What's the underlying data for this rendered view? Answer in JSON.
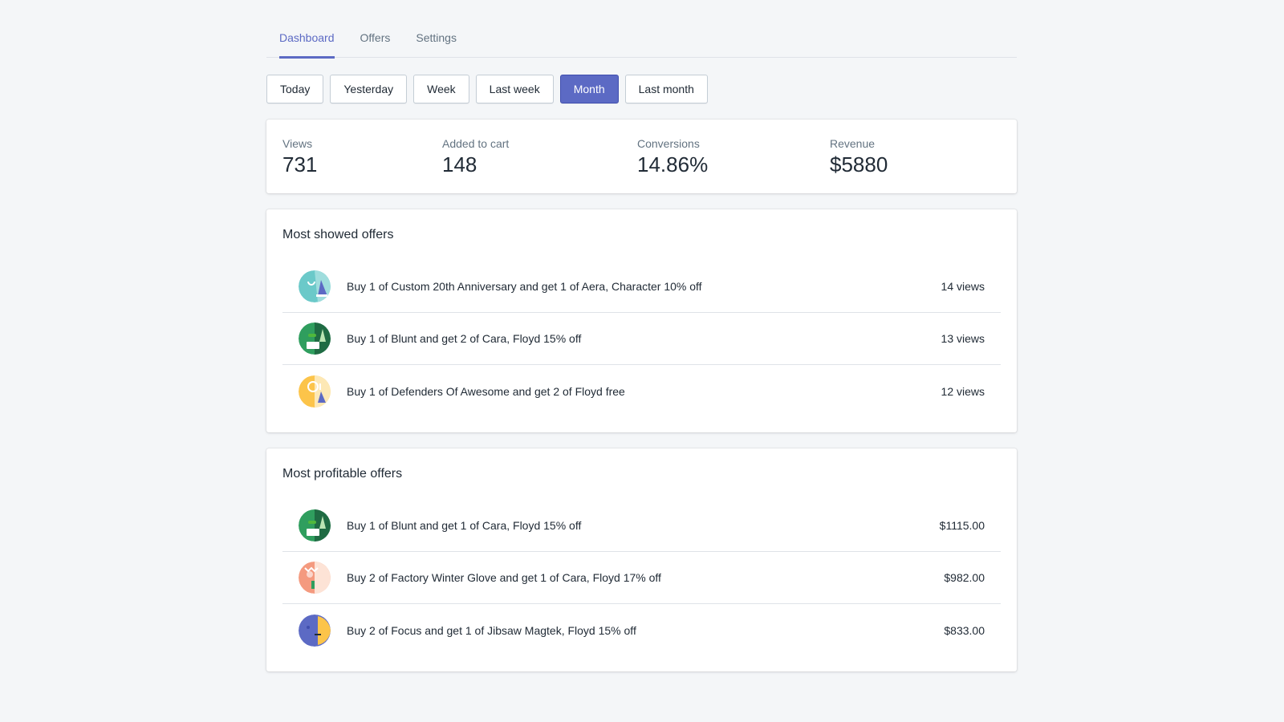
{
  "tabs": [
    {
      "label": "Dashboard",
      "active": true
    },
    {
      "label": "Offers",
      "active": false
    },
    {
      "label": "Settings",
      "active": false
    }
  ],
  "periods": [
    {
      "label": "Today",
      "active": false
    },
    {
      "label": "Yesterday",
      "active": false
    },
    {
      "label": "Week",
      "active": false
    },
    {
      "label": "Last week",
      "active": false
    },
    {
      "label": "Month",
      "active": true
    },
    {
      "label": "Last month",
      "active": false
    }
  ],
  "stats": [
    {
      "label": "Views",
      "value": "731"
    },
    {
      "label": "Added to cart",
      "value": "148"
    },
    {
      "label": "Conversions",
      "value": "14.86%"
    },
    {
      "label": "Revenue",
      "value": "$5880"
    }
  ],
  "most_showed": {
    "title": "Most showed offers",
    "items": [
      {
        "text": "Buy 1 of Custom 20th Anniversary and get 1 of Aera, Character 10% off",
        "metric": "14 views",
        "avatar": "teal-avatar-icon"
      },
      {
        "text": "Buy 1 of Blunt and get 2 of Cara, Floyd 15% off",
        "metric": "13 views",
        "avatar": "green-avatar-icon"
      },
      {
        "text": "Buy 1 of Defenders Of Awesome and get 2 of Floyd free",
        "metric": "12 views",
        "avatar": "yellow-avatar-icon"
      }
    ]
  },
  "most_profitable": {
    "title": "Most profitable offers",
    "items": [
      {
        "text": "Buy 1 of Blunt and get 1 of Cara, Floyd 15% off",
        "metric": "$1115.00",
        "avatar": "green-avatar-icon"
      },
      {
        "text": "Buy 2 of Factory Winter Glove and get 1 of Cara, Floyd 17% off",
        "metric": "$982.00",
        "avatar": "peach-avatar-icon"
      },
      {
        "text": "Buy 2 of Focus and get 1 of Jibsaw Magtek, Floyd 15% off",
        "metric": "$833.00",
        "avatar": "indigo-avatar-icon"
      }
    ]
  },
  "colors": {
    "accent": "#5c6ac4",
    "background": "#f4f6f8",
    "text": "#212b36",
    "subdued": "#637381"
  }
}
